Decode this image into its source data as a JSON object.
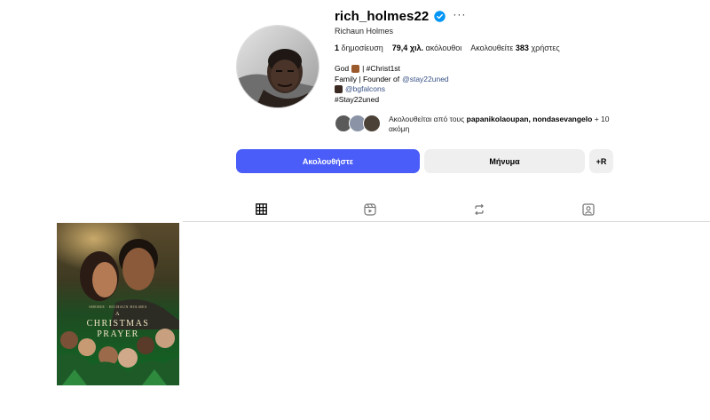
{
  "profile": {
    "username": "rich_holmes22",
    "full_name": "Richaun Holmes",
    "stats": {
      "posts_count": "1",
      "posts_label": "δημοσίευση",
      "followers_count": "79,4 χιλ.",
      "followers_label": "ακόλουθοι",
      "following_prefix": "Ακολουθείτε",
      "following_count": "383",
      "following_suffix": "χρήστες"
    },
    "bio": {
      "line1_prefix": "God",
      "line1_suffix": "| #Christ1st",
      "line2_prefix": "Family | Founder of",
      "line2_link": "@stay22uned",
      "line3_link": "@bgfalcons",
      "line4": "#Stay22uned"
    },
    "followed_by": {
      "prefix": "Ακολουθείται από τους",
      "names": "papanikolaoupan, nondasevangelo",
      "suffix": "+ 10 ακόμη"
    }
  },
  "actions": {
    "follow_label": "Ακολουθήστε",
    "message_label": "Μήνυμα",
    "suggest_label": "+R"
  },
  "tabs": [
    {
      "icon": "grid-icon",
      "active": true
    },
    {
      "icon": "reels-icon",
      "active": false
    },
    {
      "icon": "reposts-icon",
      "active": false
    },
    {
      "icon": "tagged-icon",
      "active": false
    }
  ],
  "posts": [
    {
      "title_line1": "A",
      "title_line2": "CHRISTMAS",
      "title_line3": "PRAYER",
      "tagline": "SHEREE · RICHAUN HOLMES"
    }
  ],
  "colors": {
    "primary_button": "#4a5df9",
    "secondary_button": "#efefef",
    "verified_badge": "#0095f6",
    "link": "#385185"
  }
}
